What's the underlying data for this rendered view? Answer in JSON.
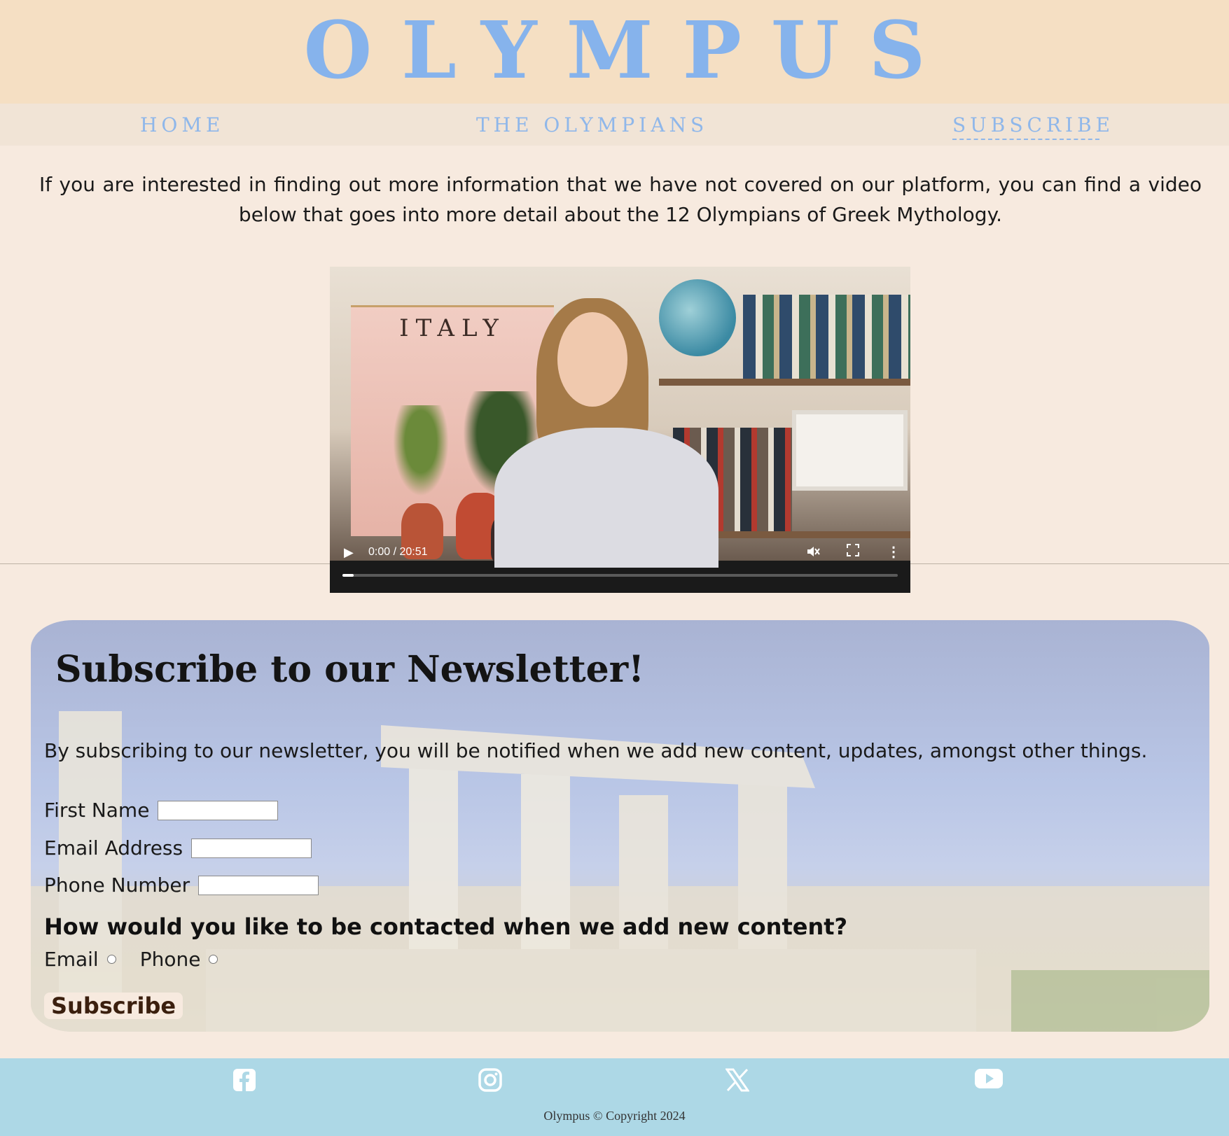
{
  "site": {
    "title": "OLYMPUS"
  },
  "nav": {
    "home": "HOME",
    "olympians": "THE OLYMPIANS",
    "subscribe": "SUBSCRIBE"
  },
  "intro": {
    "text": "If you are interested in finding out more information that we have not covered on our platform, you can find a video below that goes into more detail about the 12 Olympians of Greek Mythology."
  },
  "video": {
    "banner_text": "ITALY",
    "time": "0:00 / 20:51",
    "progress": 0.0,
    "icons": {
      "play": "play-icon",
      "mute": "mute-icon",
      "fullscreen": "fullscreen-icon",
      "more": "more-vertical-icon"
    }
  },
  "newsletter": {
    "title": "Subscribe to our Newsletter!",
    "description": "By subscribing to our newsletter, you will be notified when we add new content, updates, amongst other things.",
    "first_name_label": "First Name",
    "email_label": "Email Address",
    "phone_label": "Phone Number",
    "first_name_value": "",
    "email_value": "",
    "phone_value": "",
    "question": "How would you like to be contacted when we add new content?",
    "option_email": "Email",
    "option_phone": "Phone",
    "button": "Subscribe"
  },
  "footer": {
    "social": [
      "facebook-icon",
      "instagram-icon",
      "x-icon",
      "youtube-icon"
    ],
    "copyright": "Olympus © Copyright 2024"
  },
  "colors": {
    "header_bg": "#f5dfc3",
    "title_blue": "#86b3ec",
    "page_bg": "#f7eadf",
    "footer_bg": "#add8e6",
    "button_text": "#3b1f0e"
  }
}
